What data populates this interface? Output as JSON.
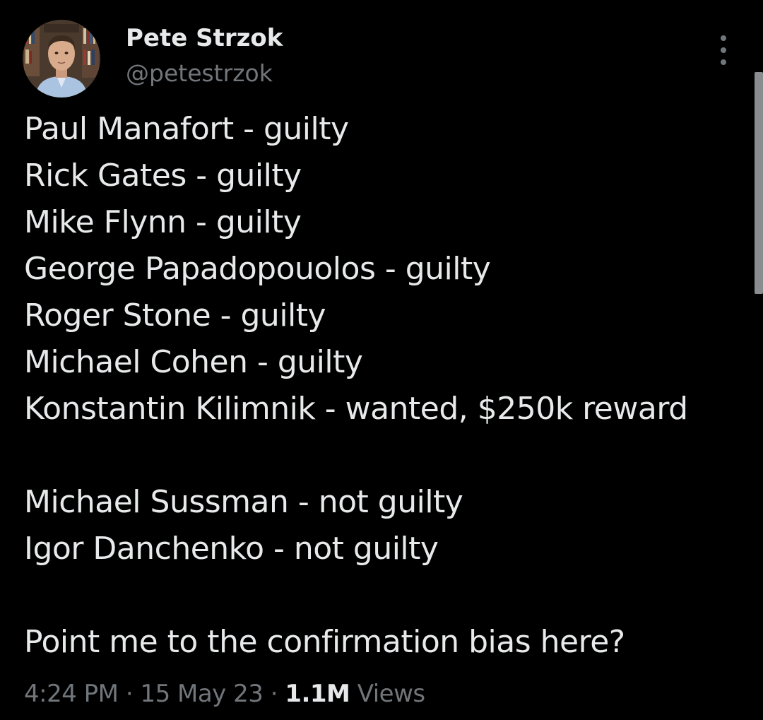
{
  "author": {
    "display_name": "Pete Strzok",
    "handle": "@petestrzok",
    "avatar_icon": "profile-photo"
  },
  "more_icon": "more-vertical-icon",
  "tweet": {
    "lines": [
      "Paul Manafort - guilty",
      "Rick Gates - guilty",
      "Mike Flynn - guilty",
      "George Papadopouolos - guilty",
      "Roger Stone - guilty",
      "Michael Cohen - guilty",
      "Konstantin Kilimnik - wanted, $250k reward",
      "",
      "Michael Sussman - not guilty",
      "Igor Danchenko - not guilty",
      "",
      "Point me to the confirmation bias here?"
    ]
  },
  "meta": {
    "time": "4:24 PM",
    "separator": "·",
    "date": "15 May 23",
    "views_count": "1.1M",
    "views_label": "Views"
  },
  "colors": {
    "background": "#000000",
    "primary_text": "#e7e9ea",
    "secondary_text": "#71767b"
  }
}
